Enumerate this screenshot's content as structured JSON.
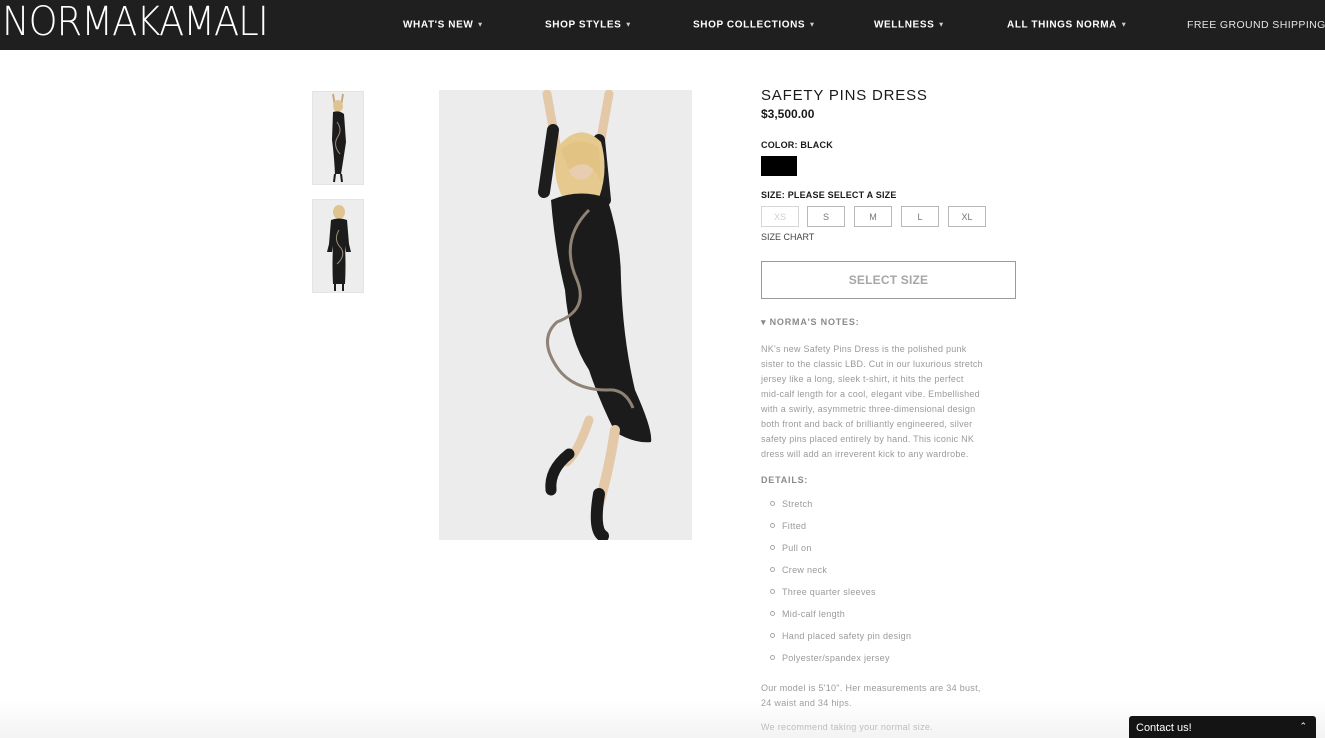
{
  "header": {
    "logo_text": "NORMAKAMALI",
    "nav": [
      {
        "label": "WHAT'S NEW"
      },
      {
        "label": "SHOP STYLES"
      },
      {
        "label": "SHOP COLLECTIONS"
      },
      {
        "label": "WELLNESS"
      },
      {
        "label": "ALL THINGS NORMA"
      }
    ],
    "shipping": "FREE GROUND SHIPPING*"
  },
  "product": {
    "title": "SAFETY PINS DRESS",
    "price": "$3,500.00",
    "color_label": "COLOR: BLACK",
    "color_swatch": "#000000",
    "size_label": "SIZE: PLEASE SELECT A SIZE",
    "sizes": [
      {
        "label": "XS",
        "available": false
      },
      {
        "label": "S",
        "available": true
      },
      {
        "label": "M",
        "available": true
      },
      {
        "label": "L",
        "available": true
      },
      {
        "label": "XL",
        "available": true
      }
    ],
    "size_chart": "SIZE CHART",
    "select_button": "SELECT SIZE",
    "notes_header": "▾ NORMA'S NOTES:",
    "notes_lines": [
      "NK's new Safety Pins Dress is the polished punk",
      "sister to the classic LBD. Cut in our luxurious stretch",
      "jersey like a long, sleek t-shirt, it hits the perfect",
      "mid-calf length for a cool, elegant vibe. Embellished",
      "with a swirly, asymmetric three-dimensional design",
      "both front and back of brilliantly engineered, silver",
      "safety pins placed entirely by hand. This iconic NK",
      "dress will add an irreverent kick to any wardrobe."
    ],
    "details_header": "DETAILS:",
    "details": [
      "Stretch",
      "Fitted",
      "Pull on",
      "Crew neck",
      "Three quarter sleeves",
      "Mid-calf length",
      "Hand placed safety pin design",
      "Polyester/spandex jersey"
    ],
    "model_lines": [
      "Our model is 5'10\". Her measurements are 34 bust,",
      "24 waist and 34 hips."
    ],
    "recommend": "We recommend taking your normal size."
  },
  "contact": {
    "label": "Contact us!"
  },
  "colors": {
    "header_bg": "#1f1f1f",
    "text_muted": "#9a9a9a"
  }
}
